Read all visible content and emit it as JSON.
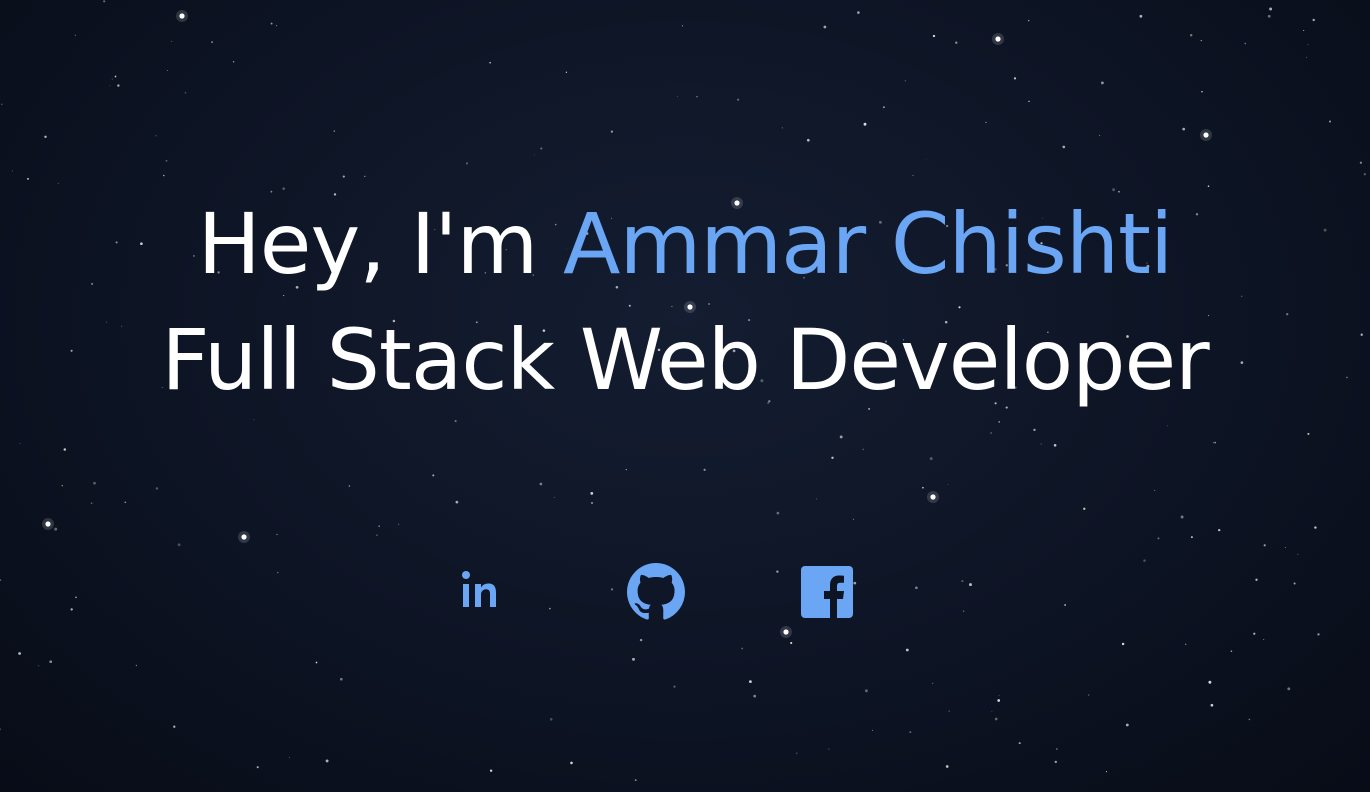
{
  "hero": {
    "greeting": "Hey, I'm ",
    "name": "Ammar Chishti",
    "role": "Full Stack Web Developer"
  },
  "socials": [
    {
      "icon": "linkedin-icon"
    },
    {
      "icon": "github-icon"
    },
    {
      "icon": "facebook-icon"
    }
  ],
  "colors": {
    "background": "#0d1424",
    "accent": "#6aa6f4",
    "text": "#ffffff"
  }
}
